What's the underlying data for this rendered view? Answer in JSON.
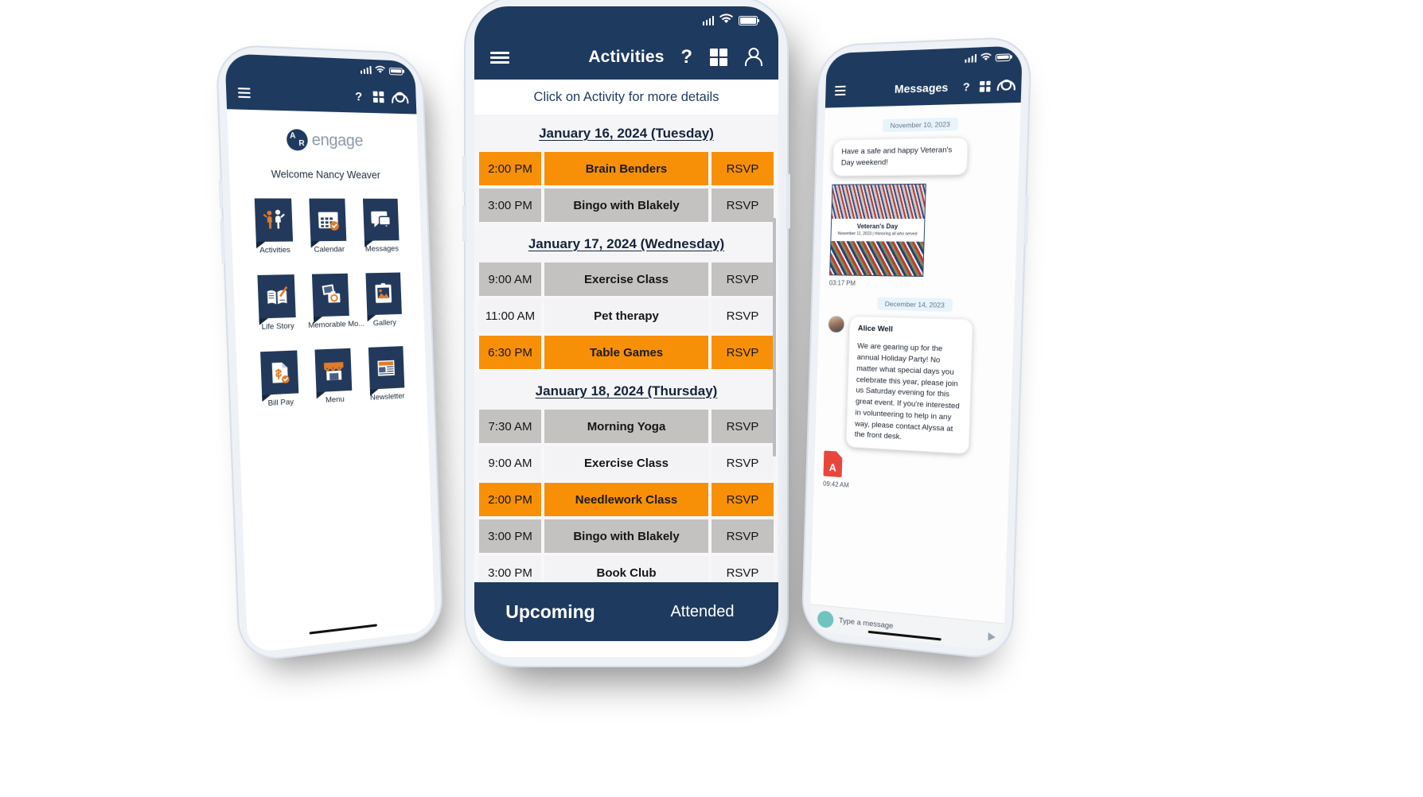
{
  "app": {
    "brand_name": "engage",
    "accent_orange": "#f79007",
    "navy": "#1f3a5f",
    "gray_row": "#c4c2c0"
  },
  "left_phone": {
    "screen_name": "Home",
    "brand_name": "engage",
    "welcome": "Welcome Nancy Weaver",
    "help_label": "?",
    "apps": [
      {
        "label": "Activities",
        "icon": "activities-icon"
      },
      {
        "label": "Calendar",
        "icon": "calendar-icon"
      },
      {
        "label": "Messages",
        "icon": "messages-icon"
      },
      {
        "label": "Life Story",
        "icon": "life-story-icon"
      },
      {
        "label": "Memorable Mo...",
        "icon": "memorable-moments-icon"
      },
      {
        "label": "Gallery",
        "icon": "gallery-icon"
      },
      {
        "label": "Bill Pay",
        "icon": "bill-pay-icon"
      },
      {
        "label": "Menu",
        "icon": "menu-icon"
      },
      {
        "label": "Newsletter",
        "icon": "newsletter-icon"
      }
    ]
  },
  "center_phone": {
    "title": "Activities",
    "help_label": "?",
    "hint": "Click on Activity for more details",
    "days": [
      {
        "date_label": "January 16, 2024 (Tuesday)",
        "rows": [
          {
            "time": "2:00 PM",
            "name": "Brain Benders",
            "rsvp": "RSVP",
            "style": "orange"
          },
          {
            "time": "3:00 PM",
            "name": "Bingo with Blakely",
            "rsvp": "RSVP",
            "style": "gray"
          }
        ]
      },
      {
        "date_label": "January 17, 2024 (Wednesday)",
        "rows": [
          {
            "time": "9:00 AM",
            "name": "Exercise Class",
            "rsvp": "RSVP",
            "style": "gray"
          },
          {
            "time": "11:00 AM",
            "name": "Pet therapy",
            "rsvp": "RSVP",
            "style": "light"
          },
          {
            "time": "6:30 PM",
            "name": "Table Games",
            "rsvp": "RSVP",
            "style": "orange"
          }
        ]
      },
      {
        "date_label": "January 18, 2024 (Thursday)",
        "rows": [
          {
            "time": "7:30 AM",
            "name": "Morning Yoga",
            "rsvp": "RSVP",
            "style": "gray"
          },
          {
            "time": "9:00 AM",
            "name": "Exercise Class",
            "rsvp": "RSVP",
            "style": "light"
          },
          {
            "time": "2:00 PM",
            "name": "Needlework Class",
            "rsvp": "RSVP",
            "style": "orange"
          },
          {
            "time": "3:00 PM",
            "name": "Bingo with Blakely",
            "rsvp": "RSVP",
            "style": "gray"
          },
          {
            "time": "3:00 PM",
            "name": "Book Club",
            "rsvp": "RSVP",
            "style": "light"
          }
        ]
      }
    ],
    "tabs": [
      {
        "label": "Upcoming",
        "active": true
      },
      {
        "label": "Attended",
        "active": false
      }
    ]
  },
  "right_phone": {
    "title": "Messages",
    "help_label": "?",
    "thread": [
      {
        "type": "date",
        "text": "November 10, 2023"
      },
      {
        "type": "bubble",
        "text": "Have a safe and happy Veteran's Day weekend!"
      },
      {
        "type": "card",
        "title": "Veteran's Day",
        "subtitle": "November 11, 2023  |  Honoring all who served"
      },
      {
        "type": "time",
        "text": "03:17 PM"
      },
      {
        "type": "date",
        "text": "December 14, 2023"
      },
      {
        "type": "message",
        "sender": "Alice Well",
        "text": "We are gearing up for the annual Holiday Party! No matter what special days you celebrate this year, please join us Saturday evening for this great event. If you're interested in volunteering to help in any way, please contact Alyssa at the front desk."
      },
      {
        "type": "attachment",
        "icon": "pdf-icon"
      },
      {
        "type": "time",
        "text": "09:42 AM"
      }
    ],
    "compose_placeholder": "Type a message"
  }
}
